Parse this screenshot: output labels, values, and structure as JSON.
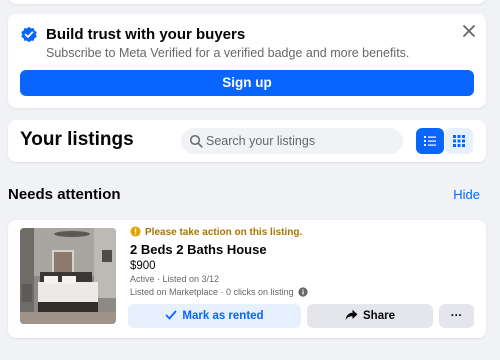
{
  "banner": {
    "title": "Build trust with your buyers",
    "subtitle": "Subscribe to Meta Verified for a verified badge and more benefits.",
    "signup_label": "Sign up",
    "badge_icon": "verified-badge-icon",
    "close_icon": "close-icon"
  },
  "listings": {
    "heading": "Your listings",
    "search_placeholder": "Search your listings",
    "search_value": "",
    "view_list_icon": "list-view-icon",
    "view_grid_icon": "grid-view-icon"
  },
  "attention": {
    "title": "Needs attention",
    "hide_label": "Hide"
  },
  "listing": {
    "warning": "Please take action on this listing.",
    "title": "2 Beds 2 Baths House",
    "price": "$900",
    "status": "Active · Listed on 3/12",
    "stats": "Listed on Marketplace · 0 clicks on listing",
    "mark_rented_label": "Mark as rented",
    "share_label": "Share",
    "more_label": "···"
  },
  "colors": {
    "accent": "#0866ff",
    "warning": "#a97700",
    "background": "#f0f2f5"
  }
}
